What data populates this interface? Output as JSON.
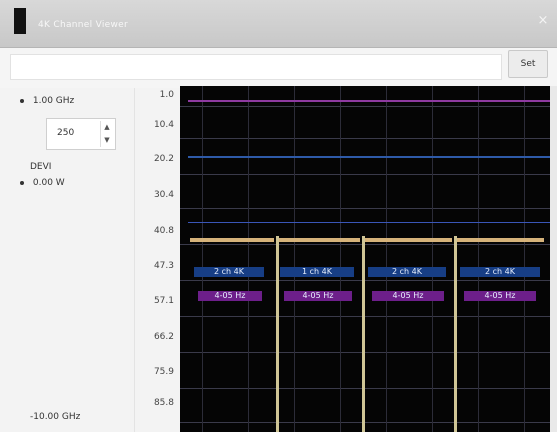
{
  "window": {
    "title": "4K Channel Viewer",
    "close_label": "×"
  },
  "toolbar": {
    "button_label": "Set"
  },
  "left_panel": {
    "freq_label": "1.00 GHz",
    "spin_value": "250",
    "mode_label": "DEVI",
    "mode_value": "0.00 W",
    "bottom_label": "-10.00 GHz"
  },
  "y_axis": {
    "labels": [
      "1.0",
      "10.4",
      "20.2",
      "30.4",
      "40.8",
      "47.3",
      "57.1",
      "66.2",
      "75.9",
      "85.8"
    ]
  },
  "traces": {
    "channels": [
      {
        "label_1": "2 ch 4K",
        "label_2": "4-05 Hz"
      },
      {
        "label_1": "1 ch 4K",
        "label_2": "4-05 Hz"
      },
      {
        "label_1": "2 ch 4K",
        "label_2": "4-05 Hz"
      },
      {
        "label_1": "2 ch 4K",
        "label_2": "4-05 Hz"
      }
    ]
  },
  "colors": {
    "plot_bg": "#050505",
    "trace_magenta": "#c23bd1",
    "trace_blue": "#3f6fd6",
    "trace_tan": "#d6b37b",
    "trace_yellow": "#cfc596",
    "label_cyan": "#2b6fd0",
    "label_pink": "#b23ccf"
  }
}
